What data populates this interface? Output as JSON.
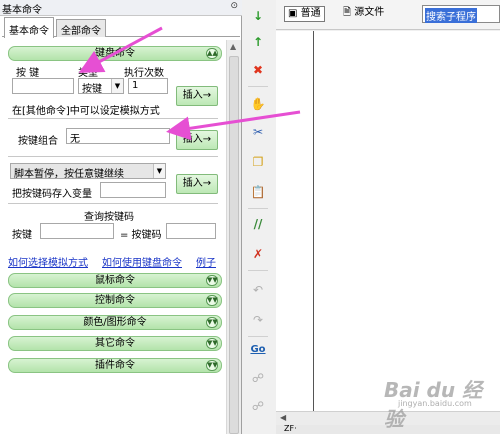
{
  "panel": {
    "title": "基本命令",
    "pin": "⊙",
    "tabs": [
      {
        "label": "基本命令",
        "active": true
      },
      {
        "label": "全部命令",
        "active": false
      }
    ]
  },
  "keyboard": {
    "section_title": "键盘命令",
    "col_key": "按 键",
    "col_type": "类型",
    "col_repeat": "执行次数",
    "key_value": "",
    "type_value": "按键",
    "repeat_value": "1",
    "insert_label": "插入→",
    "note": "在[其他命令]中可以设定模拟方式",
    "combo_label": "按键组合",
    "combo_value": "无",
    "pause_option": "脚本暂停，按任意键继续",
    "save_key_label": "把按键码存入变量",
    "save_key_value": "",
    "query_title": "查询按键码",
    "query_key_label": "按键",
    "query_key_value": "",
    "query_code_label": "= 按键码",
    "query_code_value": ""
  },
  "links": {
    "simulate": "如何选择模拟方式",
    "howto": "如何使用键盘命令",
    "example": "例子"
  },
  "sections": [
    {
      "label": "鼠标命令"
    },
    {
      "label": "控制命令"
    },
    {
      "label": "颜色/图形命令"
    },
    {
      "label": "其它命令"
    },
    {
      "label": "插件命令"
    }
  ],
  "editor": {
    "tab_normal": "普通",
    "tab_source": "源文件",
    "search_text": "搜索子程序",
    "bottom_tab": "ZF·"
  },
  "toolbar": {
    "go_label": "Go",
    "items": [
      "arrow-down-icon",
      "arrow-up-icon",
      "delete-icon",
      "hand-icon",
      "scissors-icon",
      "copy-icon",
      "paste-icon",
      "comment-icon",
      "uncomment-icon",
      "undo-icon",
      "redo-icon",
      "go-icon",
      "find-icon",
      "replace-icon"
    ]
  },
  "watermark": {
    "text1": "Bai du 经验",
    "text2": "jingyan.baidu.com"
  },
  "colors": {
    "section_green": "#b3e3aa",
    "link_blue": "#1a35c7",
    "arrow_magenta": "#e64fd3"
  }
}
